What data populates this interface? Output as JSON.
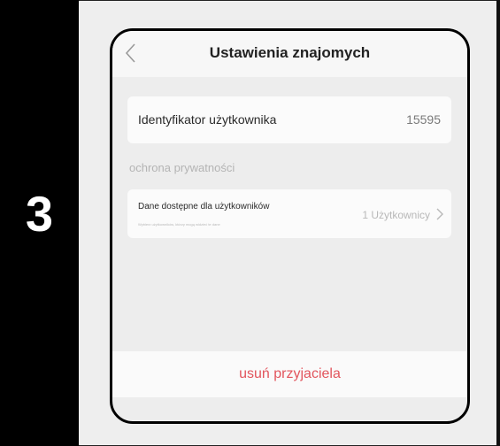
{
  "step": {
    "number": "3"
  },
  "nav": {
    "title": "Ustawienia znajomych",
    "back_icon": "chevron-left-icon"
  },
  "identifier": {
    "label": "Identyfikator użytkownika",
    "value": "15595"
  },
  "privacy": {
    "section_title": "ochrona prywatności",
    "row": {
      "label": "Dane dostępne dla użytkowników",
      "sublabel": "Wybierz użytkowników, którzy mogą widzieć te dane",
      "value": "1 Użytkownicy",
      "chevron_icon": "chevron-right-icon"
    }
  },
  "actions": {
    "delete_label": "usuń przyjaciela"
  },
  "colors": {
    "accent_delete": "#e2555d",
    "step_bar": "#000000",
    "background": "#ededed"
  }
}
